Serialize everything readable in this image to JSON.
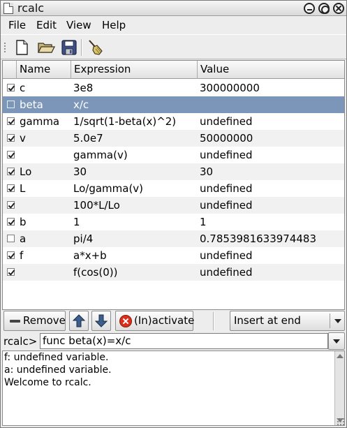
{
  "window": {
    "title": "rcalc"
  },
  "menu": [
    "File",
    "Edit",
    "View",
    "Help"
  ],
  "toolbar": {
    "items": [
      {
        "name": "new-document-icon"
      },
      {
        "name": "open-folder-icon"
      },
      {
        "name": "save-disk-icon"
      },
      {
        "name": "clear-broom-icon"
      }
    ]
  },
  "table": {
    "columns": [
      "Name",
      "Expression",
      "Value"
    ],
    "rows": [
      {
        "active": true,
        "name": "c",
        "expression": "3e8",
        "value": "300000000"
      },
      {
        "active": false,
        "name": "beta",
        "expression": "x/c",
        "value": "",
        "selected": true
      },
      {
        "active": true,
        "name": "gamma",
        "expression": "1/sqrt(1-beta(x)^2)",
        "value": "undefined"
      },
      {
        "active": true,
        "name": "v",
        "expression": "5.0e7",
        "value": "50000000"
      },
      {
        "active": true,
        "name": "",
        "expression": "gamma(v)",
        "value": "undefined"
      },
      {
        "active": true,
        "name": "Lo",
        "expression": "30",
        "value": "30"
      },
      {
        "active": true,
        "name": "L",
        "expression": "Lo/gamma(v)",
        "value": "undefined"
      },
      {
        "active": true,
        "name": "",
        "expression": "100*L/Lo",
        "value": "undefined"
      },
      {
        "active": true,
        "name": "b",
        "expression": "1",
        "value": "1"
      },
      {
        "active": false,
        "name": "a",
        "expression": "pi/4",
        "value": "0.7853981633974483"
      },
      {
        "active": true,
        "name": "f",
        "expression": "a*x+b",
        "value": "undefined"
      },
      {
        "active": true,
        "name": "",
        "expression": "f(cos(0))",
        "value": "undefined"
      }
    ]
  },
  "actions": {
    "remove_label": "Remove",
    "activate_label": "(In)activate",
    "insert_mode": "Insert at end"
  },
  "command": {
    "prompt": "rcalc>",
    "value": "func beta(x)=x/c"
  },
  "output": [
    "f: undefined variable.",
    "a: undefined variable.",
    "Welcome to rcalc."
  ]
}
